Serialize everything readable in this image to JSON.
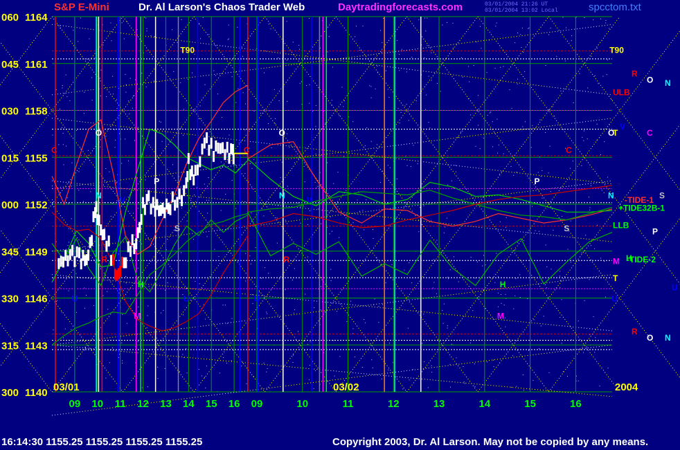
{
  "header": {
    "instrument": "S&P E-Mini",
    "title": "Dr. Al Larson's Chaos Trader Web",
    "site": "Daytradingforecasts.com",
    "file": "spcctom.txt",
    "stamp1": "03/01/2004 21:26 UT",
    "stamp2": "03/01/2004 13:02 Local"
  },
  "footer": {
    "quote": "16:14:30  1155.25  1155.25  1155.25  1155.25",
    "copyright": "Copyright 2003, Dr. Al Larson. May not be copied by any means."
  },
  "colors": {
    "background": "#000080",
    "price_bar": "#ffffff",
    "price_down": "#ff0000",
    "price_up": "#ffff00",
    "tide": "#00c000",
    "envelope": "#cc0000",
    "grid_yellow": "#ffff00",
    "grid_green": "#00a000"
  },
  "chart_data": {
    "type": "line",
    "ylim": [
      1140,
      1164
    ],
    "y_ticks": [
      {
        "value": 1164,
        "left": "060",
        "right": "1164"
      },
      {
        "value": 1161,
        "left": "045",
        "right": "1161"
      },
      {
        "value": 1158,
        "left": "030",
        "right": "1158"
      },
      {
        "value": 1155,
        "left": "015",
        "right": "1155"
      },
      {
        "value": 1152,
        "left": "000",
        "right": "1152"
      },
      {
        "value": 1149,
        "left": "345",
        "right": "1149"
      },
      {
        "value": 1146,
        "left": "330",
        "right": "1146"
      },
      {
        "value": 1143,
        "left": "315",
        "right": "1143"
      },
      {
        "value": 1140,
        "left": "300",
        "right": "1140"
      }
    ],
    "x_ticks": [
      "09",
      "10",
      "11",
      "12",
      "13",
      "14",
      "15",
      "16",
      "09",
      "10",
      "11",
      "12",
      "13",
      "14",
      "15",
      "16"
    ],
    "date_labels": [
      "03/01",
      "03/02",
      "2004"
    ],
    "price": [
      {
        "t": 8.3,
        "v": 1148.2
      },
      {
        "t": 8.6,
        "v": 1148.5
      },
      {
        "t": 8.9,
        "v": 1148.7
      },
      {
        "t": 9.2,
        "v": 1148.6
      },
      {
        "t": 9.45,
        "v": 1148.3
      },
      {
        "t": 9.6,
        "v": 1148.9
      },
      {
        "t": 9.75,
        "v": 1150.0
      },
      {
        "t": 9.9,
        "v": 1151.8
      },
      {
        "t": 10.0,
        "v": 1151.2
      },
      {
        "t": 10.15,
        "v": 1150.3
      },
      {
        "t": 10.3,
        "v": 1149.8
      },
      {
        "t": 10.5,
        "v": 1149.3
      },
      {
        "t": 10.7,
        "v": 1148.2
      },
      {
        "t": 10.85,
        "v": 1147.4
      },
      {
        "t": 11.0,
        "v": 1147.9
      },
      {
        "t": 11.25,
        "v": 1148.6
      },
      {
        "t": 11.45,
        "v": 1149.3
      },
      {
        "t": 11.7,
        "v": 1149.6
      },
      {
        "t": 11.85,
        "v": 1150.4
      },
      {
        "t": 12.0,
        "v": 1151.8
      },
      {
        "t": 12.25,
        "v": 1152.2
      },
      {
        "t": 12.45,
        "v": 1151.9
      },
      {
        "t": 12.7,
        "v": 1151.6
      },
      {
        "t": 12.95,
        "v": 1151.7
      },
      {
        "t": 13.2,
        "v": 1152.0
      },
      {
        "t": 13.5,
        "v": 1152.4
      },
      {
        "t": 13.7,
        "v": 1152.3
      },
      {
        "t": 13.9,
        "v": 1153.2
      },
      {
        "t": 14.0,
        "v": 1154.6
      },
      {
        "t": 14.15,
        "v": 1153.8
      },
      {
        "t": 14.3,
        "v": 1154.0
      },
      {
        "t": 14.5,
        "v": 1154.8
      },
      {
        "t": 14.7,
        "v": 1156.2
      },
      {
        "t": 14.9,
        "v": 1155.8
      },
      {
        "t": 15.1,
        "v": 1155.3
      },
      {
        "t": 15.3,
        "v": 1155.6
      },
      {
        "t": 15.5,
        "v": 1155.4
      },
      {
        "t": 15.7,
        "v": 1155.3
      },
      {
        "t": 15.95,
        "v": 1155.2
      },
      {
        "t": 16.0,
        "v": 1155.25
      }
    ],
    "series": [
      {
        "name": "TIDE-1",
        "color": "#ff3030",
        "day1": [
          1153.8,
          1152.0,
          1154.5,
          1156.8,
          1157.4,
          1154.0,
          1150.0,
          1148.8,
          1149.3,
          1151.0,
          1152.6,
          1154.6,
          1156.2,
          1157.3,
          1158.5,
          1159.2,
          1159.6
        ],
        "day2": [
          1154.9,
          1155.8,
          1156.0,
          1153.6,
          1151.5,
          1150.8,
          1151.7,
          1151.6,
          1150.9,
          1150.6,
          1150.9,
          1151.4,
          1151.1,
          1150.8,
          1151.0,
          1151.3,
          1151.7
        ]
      },
      {
        "name": "+TIDE32B-1",
        "color": "#00d000",
        "day1": [
          1147.0,
          1148.5,
          1150.3,
          1149.5,
          1148.0,
          1148.1,
          1151.5,
          1154.2,
          1156.8,
          1156.5,
          1155.8,
          1155.0,
          1154.6,
          1154.2,
          1154.5,
          1154.0,
          1154.8
        ],
        "day2": [
          1154.9,
          1153.6,
          1152.5,
          1151.9,
          1152.8,
          1152.6,
          1152.0,
          1152.3,
          1153.4,
          1153.1,
          1152.5,
          1152.6,
          1152.3,
          1151.9,
          1151.5,
          1151.5,
          1151.6
        ]
      },
      {
        "name": "-TIDE-2",
        "color": "#00b000",
        "day1": [
          1149.5,
          1148.4,
          1149.8,
          1147.9,
          1146.8,
          1148.9,
          1149.9,
          1147.2,
          1146.4,
          1147.8,
          1149.4,
          1150.6,
          1150.0,
          1151.0,
          1150.2,
          1150.9,
          1151.3
        ],
        "day2": [
          1151.5,
          1148.7,
          1149.5,
          1148.8,
          1149.6,
          1147.4,
          1148.2,
          1147.5,
          1149.7,
          1147.9,
          1146.8,
          1148.8,
          1149.8,
          1146.9,
          1148.3,
          1149.6,
          1150.2
        ]
      },
      {
        "name": "LLB",
        "color": "#00a000",
        "day1": [
          1143.0,
          1143.6,
          1144.1,
          1144.4,
          1144.8,
          1145.1,
          1145.0,
          1146.2,
          1147.5,
          1148.1,
          1148.8,
          1149.6,
          1150.2,
          1150.7,
          1150.9,
          1151.2,
          1151.4
        ],
        "day2": [
          1151.5,
          1151.7,
          1151.8,
          1152.2,
          1152.5,
          1152.8,
          1152.7,
          1152.6,
          1152.9,
          1152.4,
          1152.0,
          1151.6,
          1151.3,
          1151.2,
          1151.0,
          1151.4,
          1151.8
        ]
      },
      {
        "name": "ULB",
        "color": "#cc0000",
        "day1": [
          1151.5,
          1150.7,
          1150.3,
          1150.4,
          1149.8,
          1148.2,
          1145.8,
          1144.6,
          1144.2,
          1143.9,
          1144.1,
          1144.5,
          1145.0,
          1146.2,
          1147.6,
          1148.8,
          1150.0
        ],
        "day2": [
          1150.6,
          1150.9,
          1151.4,
          1151.2,
          1150.8,
          1150.5,
          1150.6,
          1151.0,
          1151.3,
          1151.6,
          1152.0,
          1152.3,
          1152.5,
          1152.6,
          1152.8,
          1153.0,
          1153.2
        ]
      }
    ],
    "right_labels": [
      {
        "text": "R",
        "value": 1160.4,
        "color": "#ff0000"
      },
      {
        "text": "O",
        "value": 1160.0,
        "color": "#ffffff"
      },
      {
        "text": "N",
        "value": 1159.8,
        "color": "#00ffff"
      },
      {
        "text": "ULB",
        "value": 1159.2,
        "color": "#ff0000"
      },
      {
        "text": "V",
        "value": 1157.0,
        "color": "#0000ff"
      },
      {
        "text": "O",
        "value": 1156.6,
        "color": "#ffffff"
      },
      {
        "text": "T",
        "value": 1156.6,
        "color": "#ffff00"
      },
      {
        "text": "C",
        "value": 1156.6,
        "color": "#ff00ff"
      },
      {
        "text": "S",
        "value": 1152.6,
        "color": "#c0c0c0"
      },
      {
        "text": "N",
        "value": 1152.6,
        "color": "#00ffff"
      },
      {
        "text": "-TIDE-1",
        "value": 1152.3,
        "color": "#ff3030"
      },
      {
        "text": "+TIDE32B-1",
        "value": 1151.8,
        "color": "#00ff00"
      },
      {
        "text": "LLB",
        "value": 1150.7,
        "color": "#00ff00"
      },
      {
        "text": "P",
        "value": 1150.3,
        "color": "#ffffff"
      },
      {
        "text": "H",
        "value": 1148.6,
        "color": "#00ff00"
      },
      {
        "text": "-TIDE-2",
        "value": 1148.5,
        "color": "#00ff00"
      },
      {
        "text": "M",
        "value": 1148.4,
        "color": "#ff00ff"
      },
      {
        "text": "T",
        "value": 1147.3,
        "color": "#ffff00"
      },
      {
        "text": "U",
        "value": 1146.7,
        "color": "#0000ff"
      },
      {
        "text": "R",
        "value": 1143.9,
        "color": "#ff0000"
      },
      {
        "text": "O",
        "value": 1143.5,
        "color": "#ffffff"
      },
      {
        "text": "N",
        "value": 1143.5,
        "color": "#00ffff"
      }
    ],
    "markers": [
      {
        "text": "T90",
        "t": 13.95,
        "v": 1161.9,
        "color": "#ffff00"
      },
      {
        "text": "T90",
        "t": 32.8,
        "v": 1161.9,
        "color": "#ffff00"
      },
      {
        "text": "C",
        "t": 8.1,
        "v": 1155.5,
        "color": "#ff0000"
      },
      {
        "text": "C",
        "t": 16.55,
        "v": 1155.5,
        "color": "#ff0000"
      },
      {
        "text": "C",
        "t": 30.7,
        "v": 1155.5,
        "color": "#ff0000"
      },
      {
        "text": "O",
        "t": 10.05,
        "v": 1156.6,
        "color": "#ffffff"
      },
      {
        "text": "O",
        "t": 18.1,
        "v": 1156.6,
        "color": "#ffffff"
      },
      {
        "text": "N",
        "t": 10.05,
        "v": 1152.6,
        "color": "#00ffff"
      },
      {
        "text": "N",
        "t": 18.1,
        "v": 1152.6,
        "color": "#00ffff"
      },
      {
        "text": "P",
        "t": 12.6,
        "v": 1153.5,
        "color": "#ffffff"
      },
      {
        "text": "P",
        "t": 29.3,
        "v": 1153.5,
        "color": "#ffffff"
      },
      {
        "text": "S",
        "t": 13.5,
        "v": 1150.5,
        "color": "#c0c0c0"
      },
      {
        "text": "S",
        "t": 30.6,
        "v": 1150.5,
        "color": "#c0c0c0"
      },
      {
        "text": "V",
        "t": 11.1,
        "v": 1152.3,
        "color": "#0000ff"
      },
      {
        "text": "V",
        "t": 19.3,
        "v": 1152.3,
        "color": "#0000ff"
      },
      {
        "text": "H",
        "t": 11.9,
        "v": 1146.9,
        "color": "#00ff00"
      },
      {
        "text": "H",
        "t": 27.8,
        "v": 1146.9,
        "color": "#00ff00"
      },
      {
        "text": "M",
        "t": 11.75,
        "v": 1144.9,
        "color": "#ff00ff"
      },
      {
        "text": "M",
        "t": 27.7,
        "v": 1144.9,
        "color": "#ff00ff"
      },
      {
        "text": "R",
        "t": 10.3,
        "v": 1148.5,
        "color": "#ff0000"
      },
      {
        "text": "R",
        "t": 18.3,
        "v": 1148.5,
        "color": "#ff0000"
      },
      {
        "text": "U",
        "t": 9.0,
        "v": 1146.0,
        "color": "#0000ff"
      },
      {
        "text": "U",
        "t": 13.9,
        "v": 1146.0,
        "color": "#0000ff"
      },
      {
        "text": "U",
        "t": 17.0,
        "v": 1146.0,
        "color": "#0000ff"
      },
      {
        "text": "U",
        "t": 32.7,
        "v": 1146.0,
        "color": "#0000ff"
      }
    ]
  }
}
